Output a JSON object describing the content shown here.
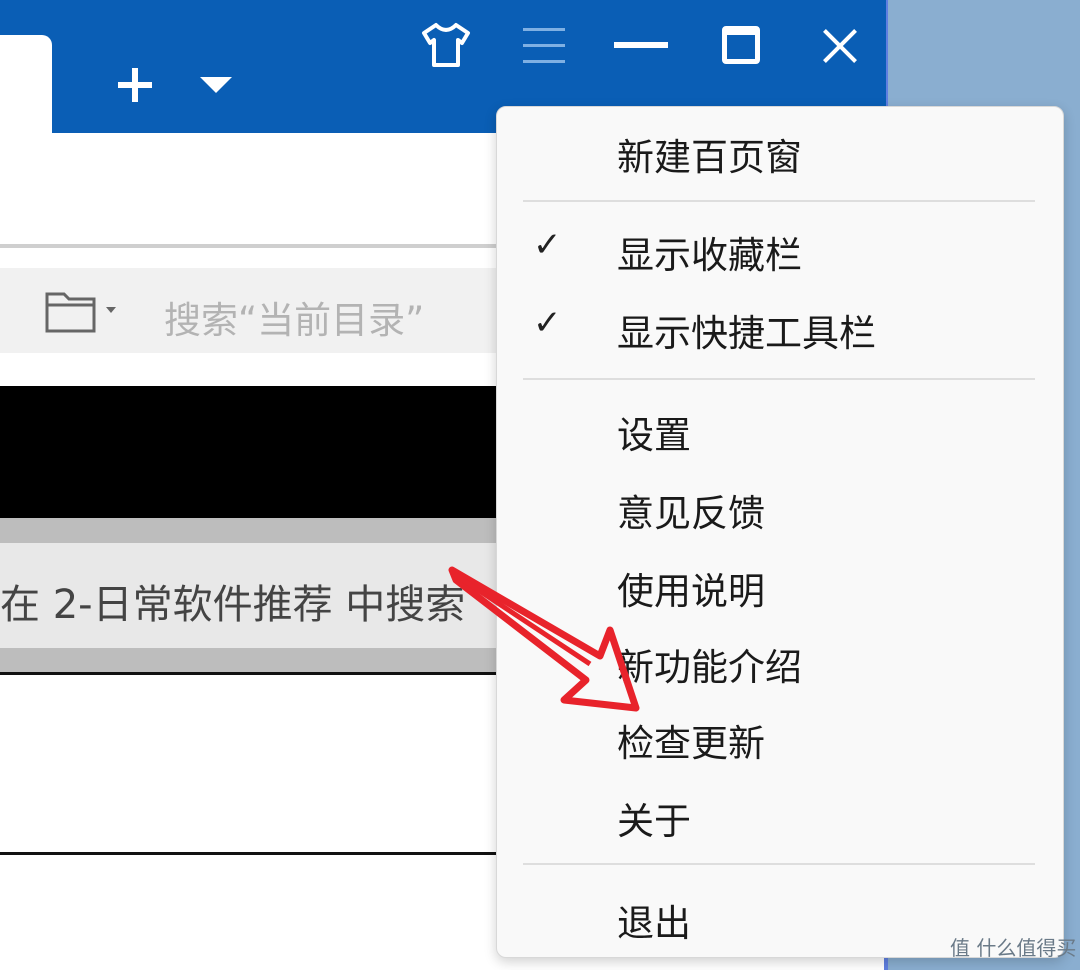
{
  "titlebar": {
    "new_tab_icon": "plus-icon",
    "dropdown_icon": "caret-down-icon",
    "skin_icon": "shirt-icon",
    "menu_icon": "hamburger-icon",
    "minimize_icon": "minimize-icon",
    "maximize_icon": "maximize-icon",
    "close_icon": "close-icon"
  },
  "search": {
    "placeholder": "搜索“当前目录”",
    "folder_icon": "folder-icon"
  },
  "content": {
    "hint": "在 2-日常软件推荐 中搜索"
  },
  "menu": {
    "new_window": "新建百页窗",
    "show_favorites": "显示收藏栏",
    "show_quick_toolbar": "显示快捷工具栏",
    "check_mark": "✓",
    "settings": "设置",
    "feedback": "意见反馈",
    "instructions": "使用说明",
    "new_features": "新功能介绍",
    "check_update": "检查更新",
    "about": "关于",
    "exit": "退出"
  },
  "watermark": "值 什么值得买",
  "colors": {
    "titlebar": "#0a5eb5",
    "arrow": "#e8232b"
  }
}
